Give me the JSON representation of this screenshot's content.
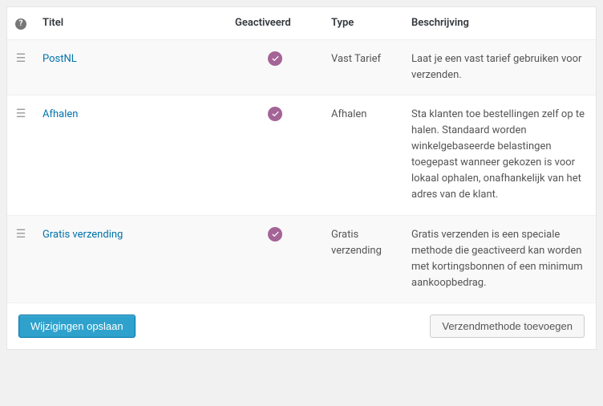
{
  "headers": {
    "title": "Titel",
    "activated": "Geactiveerd",
    "type": "Type",
    "description": "Beschrijving"
  },
  "rows": [
    {
      "title": "PostNL",
      "activated": true,
      "type": "Vast Tarief",
      "description": "Laat je een vast tarief gebruiken voor verzenden."
    },
    {
      "title": "Afhalen",
      "activated": true,
      "type": "Afhalen",
      "description": "Sta klanten toe bestellingen zelf op te halen. Standaard worden winkelgebaseerde belastingen toegepast wanneer gekozen is voor lokaal ophalen, onafhankelijk van het adres van de klant."
    },
    {
      "title": "Gratis verzending",
      "activated": true,
      "type": "Gratis verzending",
      "description": "Gratis verzenden is een speciale methode die geactiveerd kan worden met kortingsbonnen of een minimum aankoopbedrag."
    }
  ],
  "buttons": {
    "save": "Wijzigingen opslaan",
    "add_method": "Verzendmethode toevoegen"
  }
}
